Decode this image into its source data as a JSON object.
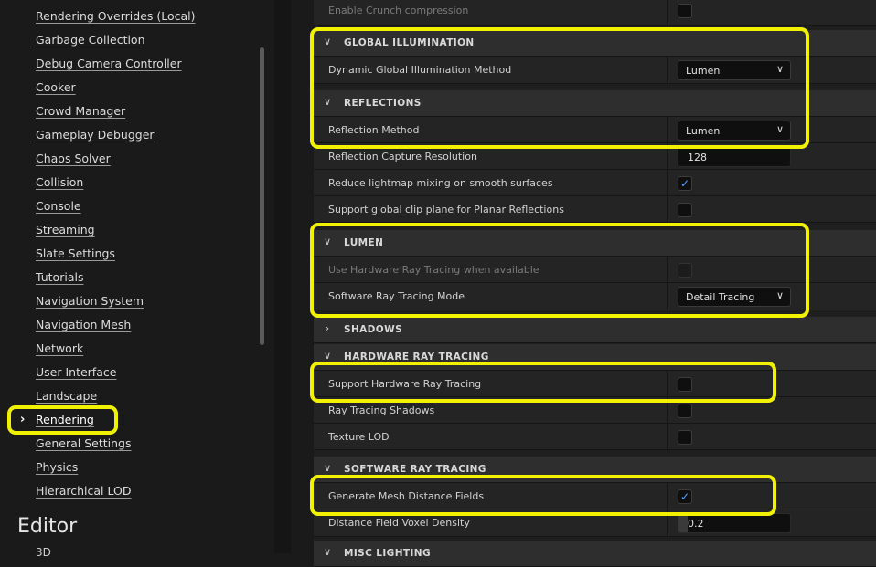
{
  "sidebar": {
    "items": [
      "Rendering Overrides (Local)",
      "Garbage Collection",
      "Debug Camera Controller",
      "Cooker",
      "Crowd Manager",
      "Gameplay Debugger",
      "Chaos Solver",
      "Collision",
      "Console",
      "Streaming",
      "Slate Settings",
      "Tutorials",
      "Navigation System",
      "Navigation Mesh",
      "Network",
      "User Interface",
      "Landscape",
      "Rendering",
      "General Settings",
      "Physics",
      "Hierarchical LOD"
    ],
    "selected_item": "Rendering",
    "section_title": "Editor",
    "section_next": "3D"
  },
  "properties": {
    "crunch": {
      "label": "Enable Crunch compression",
      "checked": false
    },
    "gi": {
      "title": "GLOBAL ILLUMINATION",
      "method": {
        "label": "Dynamic Global Illumination Method",
        "value": "Lumen"
      }
    },
    "reflections": {
      "title": "REFLECTIONS",
      "method": {
        "label": "Reflection Method",
        "value": "Lumen"
      },
      "capture": {
        "label": "Reflection Capture Resolution",
        "value": "128"
      },
      "reduce_lightmap": {
        "label": "Reduce lightmap mixing on smooth surfaces",
        "checked": true
      },
      "clip_plane": {
        "label": "Support global clip plane for Planar Reflections",
        "checked": false
      }
    },
    "lumen": {
      "title": "LUMEN",
      "hw_rt": {
        "label": "Use Hardware Ray Tracing when available",
        "checked": false
      },
      "sw_mode": {
        "label": "Software Ray Tracing Mode",
        "value": "Detail Tracing"
      }
    },
    "shadows": {
      "title": "SHADOWS"
    },
    "hw_ray_tracing": {
      "title": "HARDWARE RAY TRACING",
      "support": {
        "label": "Support Hardware Ray Tracing",
        "checked": false
      },
      "shadows": {
        "label": "Ray Tracing Shadows",
        "checked": false
      },
      "texture_lod": {
        "label": "Texture LOD",
        "checked": false
      }
    },
    "sw_ray_tracing": {
      "title": "SOFTWARE RAY TRACING",
      "mesh_df": {
        "label": "Generate Mesh Distance Fields",
        "checked": true
      },
      "voxel_density": {
        "label": "Distance Field Voxel Density",
        "value": "0.2",
        "fraction": 0.2
      }
    },
    "misc": {
      "title": "MISC LIGHTING"
    }
  },
  "colors": {
    "highlight": "#f2f200",
    "checkmark": "#5ea2ff"
  }
}
